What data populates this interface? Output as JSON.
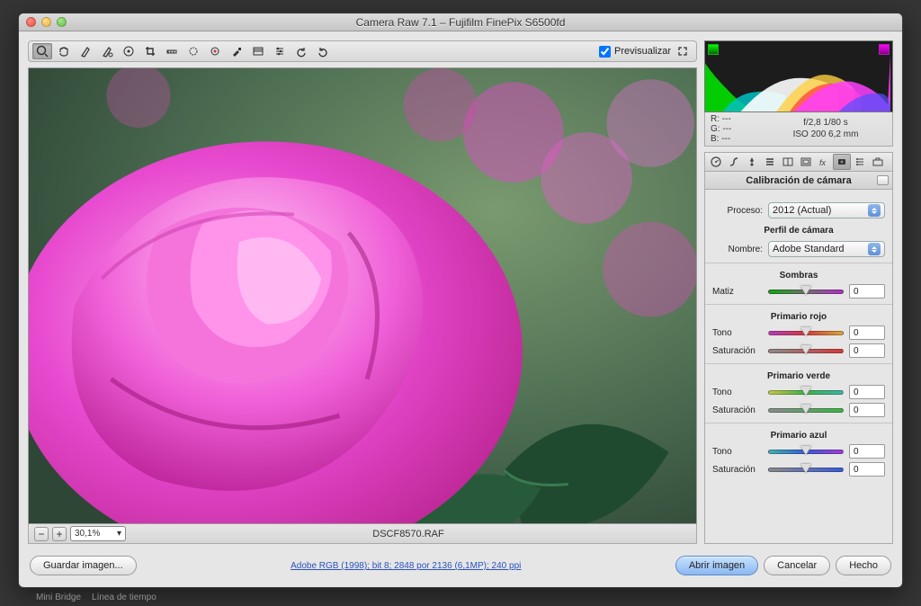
{
  "window": {
    "title": "Camera Raw 7.1  –  Fujifilm FinePix S6500fd"
  },
  "preview": {
    "label": "Previsualizar",
    "checked": true
  },
  "zoom": {
    "level": "30,1%"
  },
  "filename": "DSCF8570.RAF",
  "link_text": "Adobe RGB (1998); bit 8; 2848 por 2136 (6,1MP); 240 ppi",
  "rgb": {
    "r": "R:   ---",
    "g": "G:   ---",
    "b": "B:   ---"
  },
  "exif": {
    "line1": "f/2,8    1/80 s",
    "line2": "ISO 200   6,2 mm"
  },
  "panel": {
    "title": "Calibración de cámara",
    "process_label": "Proceso:",
    "process_value": "2012 (Actual)",
    "profile_header": "Perfil de cámara",
    "name_label": "Nombre:",
    "name_value": "Adobe Standard",
    "shadows_header": "Sombras",
    "hue_label": "Matiz",
    "primary_red": "Primario rojo",
    "primary_green": "Primario verde",
    "primary_blue": "Primario azul",
    "tone_label": "Tono",
    "sat_label": "Saturación",
    "zero": "0"
  },
  "buttons": {
    "save": "Guardar imagen...",
    "open": "Abrir imagen",
    "cancel": "Cancelar",
    "done": "Hecho"
  },
  "bg_tabs": {
    "a": "Mini Bridge",
    "b": "Línea de tiempo"
  },
  "gradients": {
    "shadows": "linear-gradient(90deg,#14a014,#707070,#b030c0)",
    "red_h": "linear-gradient(90deg,#b43abf,#d43a3a,#d4a73a)",
    "red_s": "linear-gradient(90deg,#8a8a8a,#d43a3a)",
    "grn_h": "linear-gradient(90deg,#c6c448,#3eb24a,#3eb2a8)",
    "grn_s": "linear-gradient(90deg,#8a8a8a,#3eb24a)",
    "blu_h": "linear-gradient(90deg,#3eb2a8,#3a5cd4,#a23ad4)",
    "blu_s": "linear-gradient(90deg,#8a8a8a,#3a5cd4)"
  }
}
